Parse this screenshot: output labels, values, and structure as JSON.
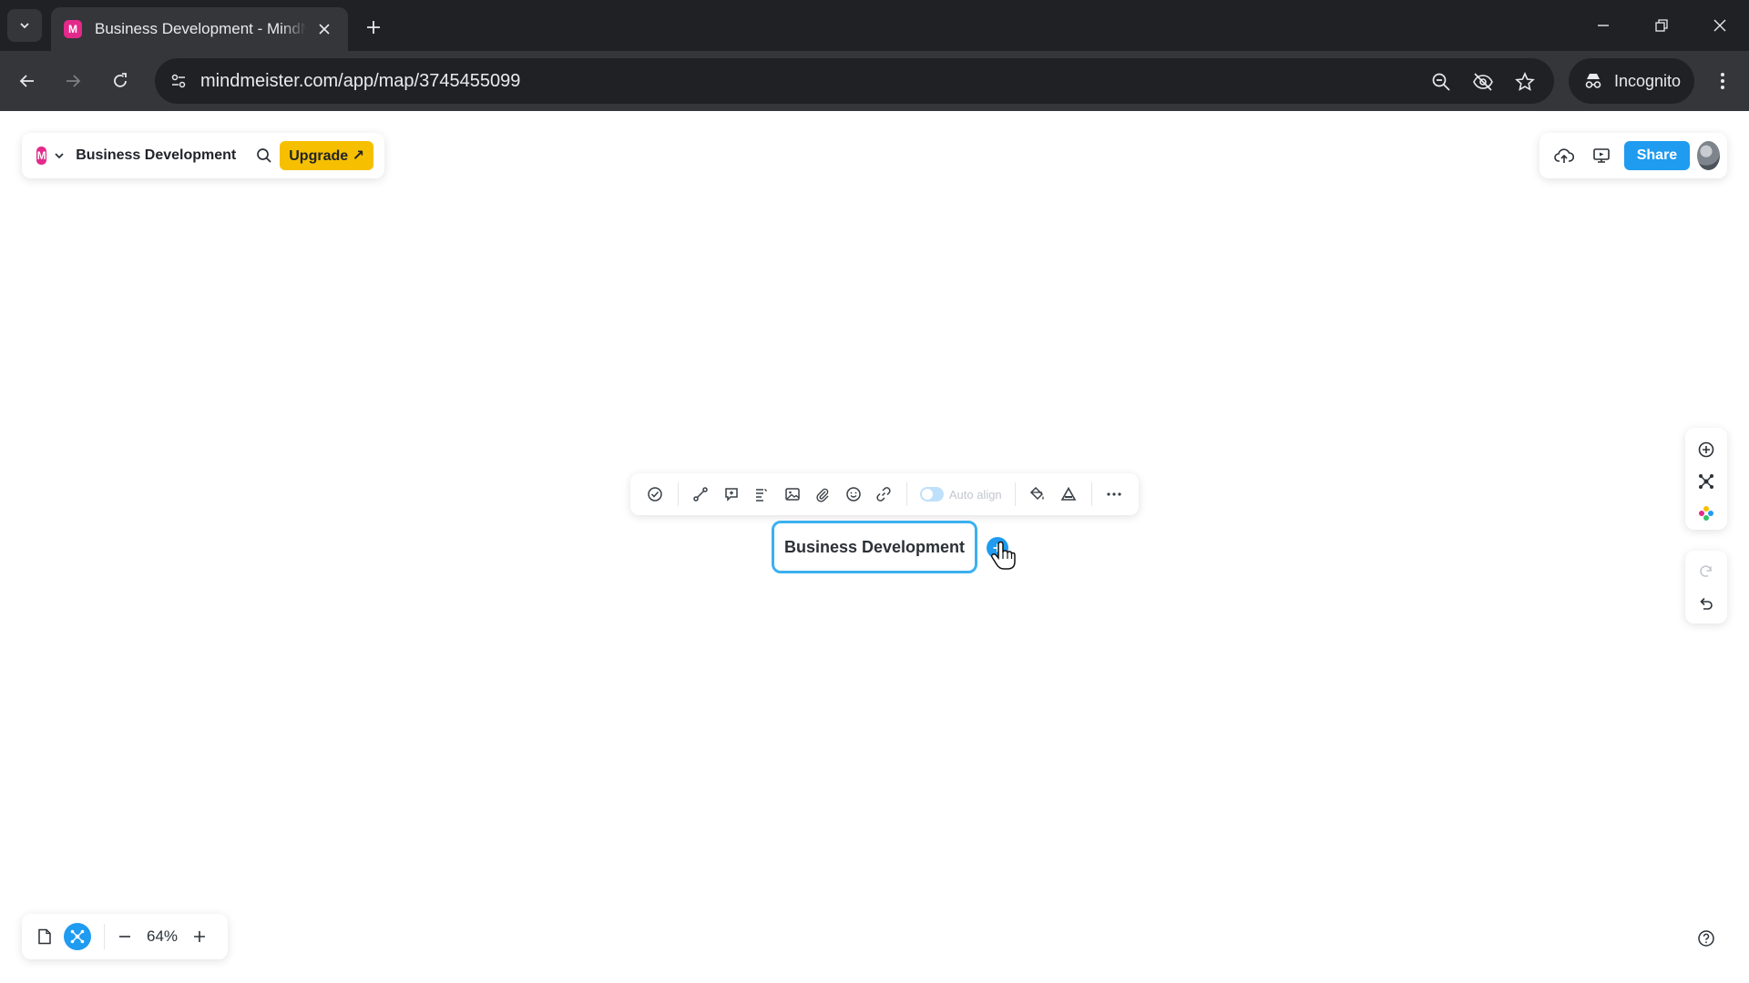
{
  "browser": {
    "tab": {
      "title": "Business Development - MindMeister",
      "favicon_letter": "M"
    },
    "url": "mindmeister.com/app/map/3745455099",
    "incognito_label": "Incognito"
  },
  "header": {
    "logo_letter": "M",
    "map_title": "Business Development",
    "upgrade_label": "Upgrade ↗",
    "share_label": "Share"
  },
  "node_toolbar": {
    "autoalign_label": "Auto align",
    "more_label": "···"
  },
  "map": {
    "root_node": "Business Development"
  },
  "zoom": {
    "level": "64%"
  },
  "colors": {
    "accent": "#1f9bf0",
    "upgrade": "#f6c000",
    "brand": "#e5298a",
    "node_border": "#3bb0f0"
  }
}
